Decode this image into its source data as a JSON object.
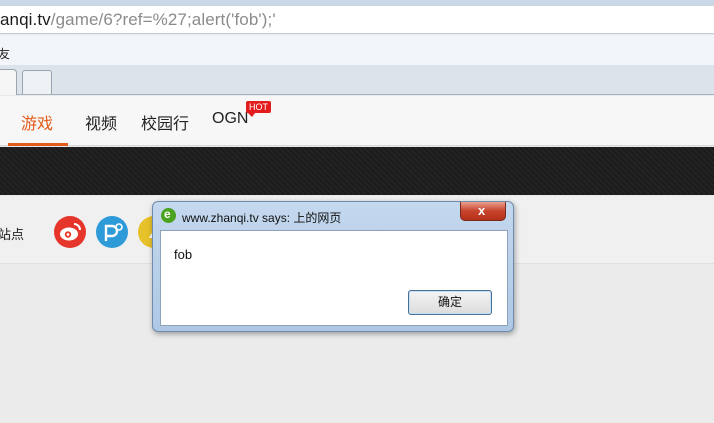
{
  "browser": {
    "url_host": "anqi.tv",
    "url_path": "/game/6?ref=%27;alert('fob');'",
    "bookmark_glyph": "友",
    "tab_close_glyph": "x"
  },
  "site_nav": {
    "items": [
      {
        "label": "游戏",
        "active": true
      },
      {
        "label": "视频",
        "active": false
      },
      {
        "label": "校园行",
        "active": false
      },
      {
        "label": "OGN",
        "active": false
      }
    ],
    "hot_badge": "HOT",
    "accent_color": "#e35b1a"
  },
  "share": {
    "label": "站点",
    "icons": [
      "weibo-icon",
      "pp-icon",
      "qzone-icon"
    ]
  },
  "dialog": {
    "title": "www.zhanqi.tv says: 上的网页",
    "message": "fob",
    "ok_label": "确定",
    "close_glyph": "x"
  }
}
